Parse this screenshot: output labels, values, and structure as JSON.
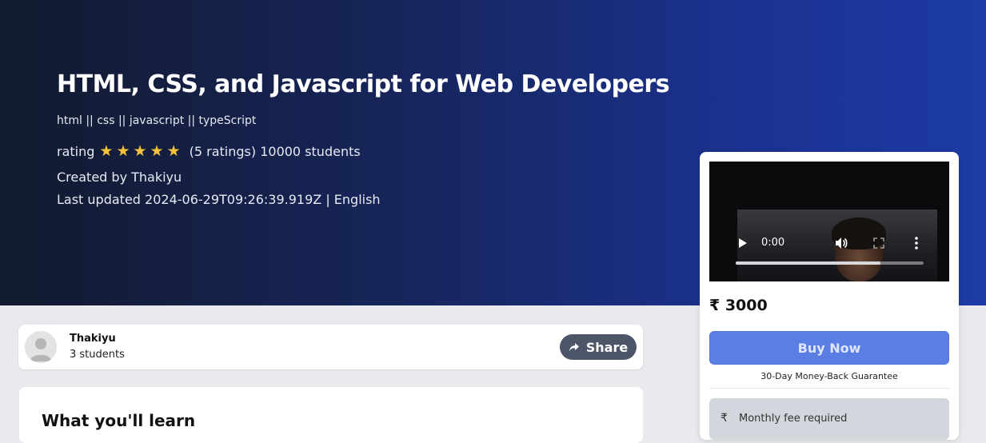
{
  "course": {
    "title": "HTML, CSS, and Javascript for Web Developers",
    "subtitle": "html || css || javascript || typeScript",
    "rating_label": "rating",
    "stars": 5,
    "ratings_text": "(5 ratings) 10000 students",
    "created_by": "Created by Thakiyu",
    "last_updated": "Last updated 2024-06-29T09:26:39.919Z | English"
  },
  "instructor": {
    "name": "Thakiyu",
    "students": "3 students",
    "share_label": "Share"
  },
  "learn": {
    "heading": "What you'll learn"
  },
  "purchase": {
    "video_time": "0:00",
    "video_progress": 0.77,
    "price": "₹ 3000",
    "buy_label": "Buy Now",
    "guarantee": "30-Day Money-Back Guarantee",
    "fee_icon": "₹",
    "fee_text": "Monthly fee required"
  },
  "colors": {
    "star": "#f6c23a",
    "buy_button": "#5b7ee5",
    "share_button": "#4c5668"
  }
}
